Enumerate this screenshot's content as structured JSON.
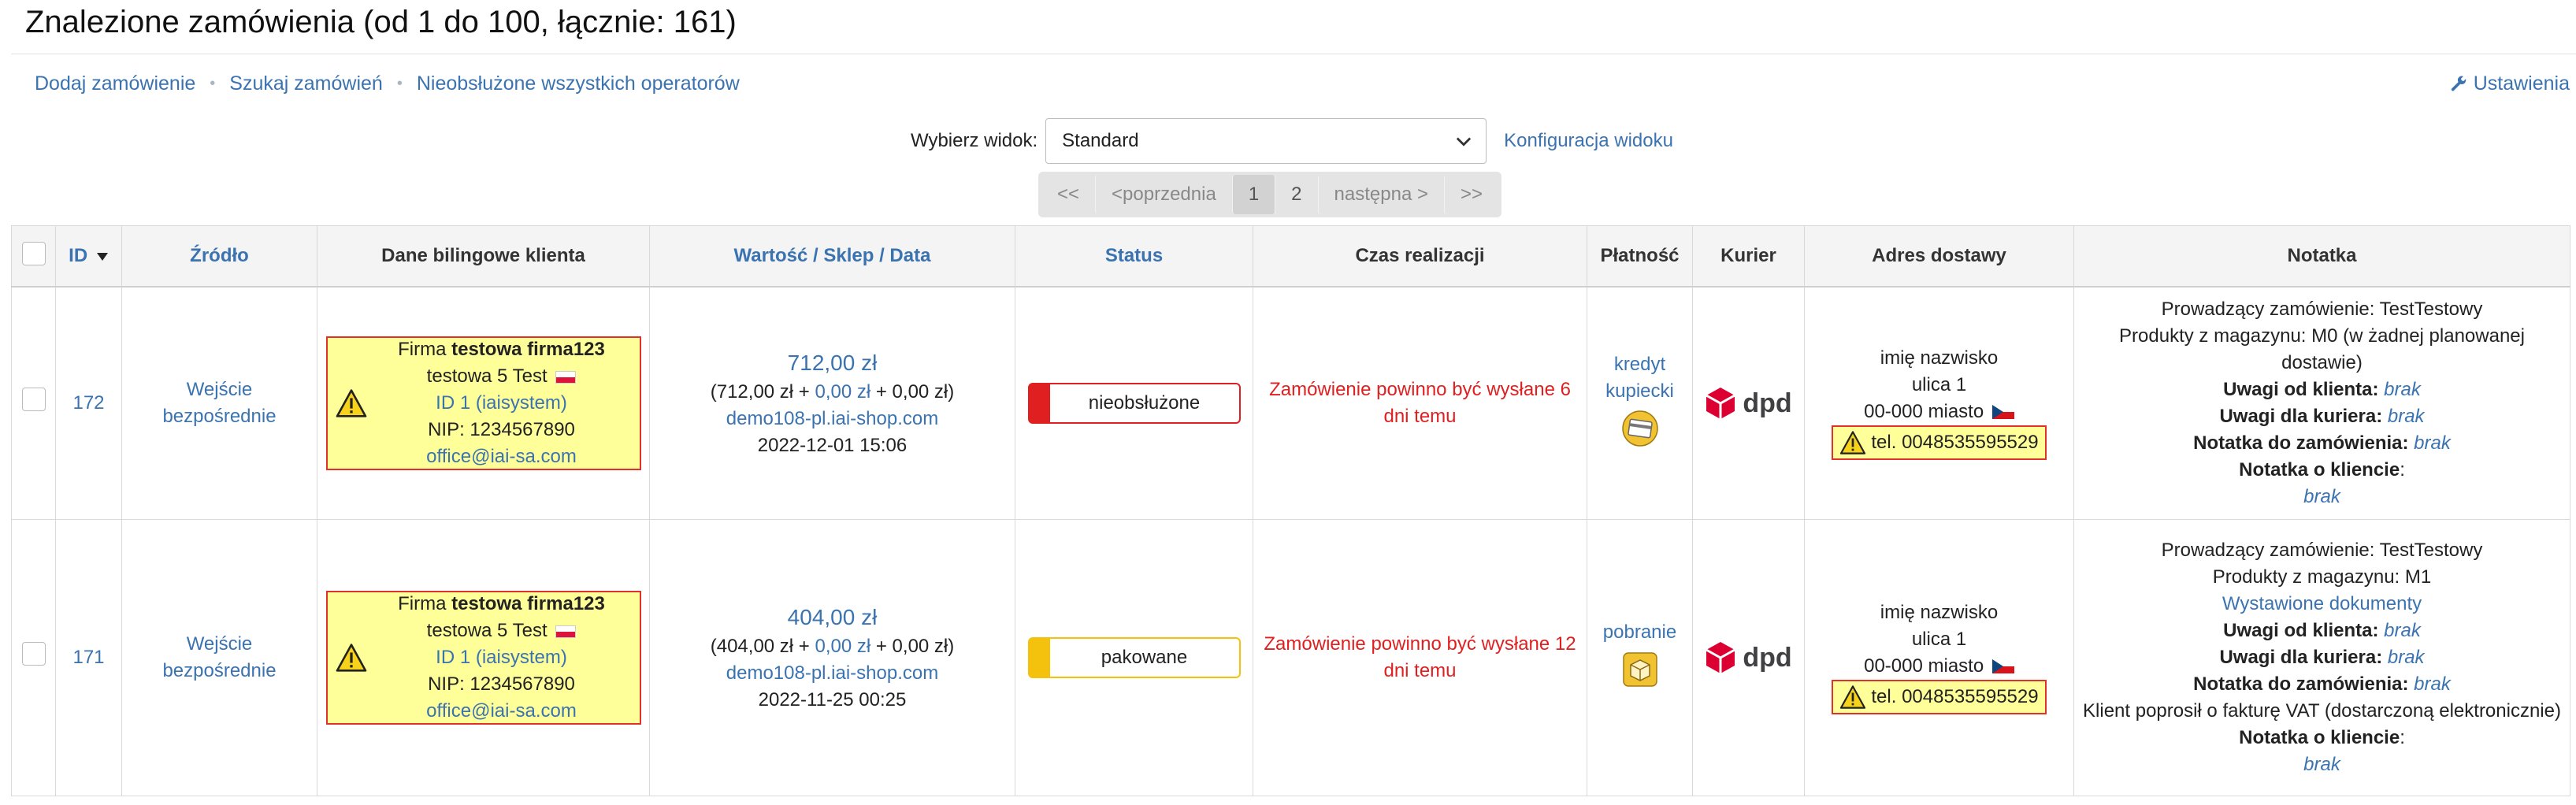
{
  "header": {
    "title": "Znalezione zamówienia (od 1 do 100, łącznie: 161)",
    "links": [
      "Dodaj zamówienie",
      "Szukaj zamówień",
      "Nieobsłużone wszystkich operatorów"
    ],
    "settings_label": "Ustawienia"
  },
  "view": {
    "label": "Wybierz widok:",
    "selected": "Standard",
    "config_label": "Konfiguracja widoku"
  },
  "pager": {
    "first": "<<",
    "prev": "<poprzednia",
    "page1": "1",
    "page2": "2",
    "next": "następna >",
    "last": ">>"
  },
  "table": {
    "headers": {
      "id": "ID",
      "source": "Źródło",
      "billing": "Dane bilingowe klienta",
      "value_a": "Wartość",
      "value_b": "Sklep",
      "value_c": "Data",
      "status": "Status",
      "time": "Czas realizacji",
      "payment": "Płatność",
      "courier": "Kurier",
      "address": "Adres dostawy",
      "note": "Notatka"
    },
    "rows": [
      {
        "id": "172",
        "source": "Wejście bezpośrednie",
        "billing": {
          "firm_prefix": "Firma",
          "firm_name": "testowa firma123",
          "person": "testowa 5 Test",
          "client_id": "ID 1 (iaisystem)",
          "nip": "NIP: 1234567890",
          "email": "office@iai-sa.com"
        },
        "amount": "712,00 zł",
        "breakdown_pre": "(712,00 zł + ",
        "breakdown_link": "0,00 zł",
        "breakdown_post": " + 0,00 zł)",
        "shop": "demo108-pl.iai-shop.com",
        "date": "2022-12-01 15:06",
        "status": "nieobsłużone",
        "status_color": "#e02020",
        "time_text": "Zamówienie powinno być wysłane 6 dni temu",
        "payment": "kredyt kupiecki",
        "payment_icon": "credit-card-icon",
        "courier": "dpd",
        "address": {
          "name": "imię nazwisko",
          "street": "ulica 1",
          "city": "00-000 miasto",
          "phone": "tel. 0048535595529"
        },
        "notes": {
          "operator": "Prowadzący zamówienie: TestTestowy",
          "warehouse": "Produkty z magazynu: M0 (w żadnej planowanej dostawie)",
          "client_label": "Uwagi od klienta:",
          "client_value": "brak",
          "courier_label": "Uwagi dla kuriera:",
          "courier_value": "brak",
          "order_label": "Notatka do zamówienia:",
          "order_value": "brak",
          "about_label": "Notatka o kliencie",
          "about_value": "brak"
        }
      },
      {
        "id": "171",
        "source": "Wejście bezpośrednie",
        "billing": {
          "firm_prefix": "Firma",
          "firm_name": "testowa firma123",
          "person": "testowa 5 Test",
          "client_id": "ID 1 (iaisystem)",
          "nip": "NIP: 1234567890",
          "email": "office@iai-sa.com"
        },
        "amount": "404,00 zł",
        "breakdown_pre": "(404,00 zł + ",
        "breakdown_link": "0,00 zł",
        "breakdown_post": " + 0,00 zł)",
        "shop": "demo108-pl.iai-shop.com",
        "date": "2022-11-25 00:25",
        "status": "pakowane",
        "status_color": "#f4c20d",
        "time_text": "Zamówienie powinno być wysłane 12 dni temu",
        "payment": "pobranie",
        "payment_icon": "cash-on-delivery-icon",
        "courier": "dpd",
        "address": {
          "name": "imię nazwisko",
          "street": "ulica 1",
          "city": "00-000 miasto",
          "phone": "tel. 0048535595529"
        },
        "notes": {
          "operator": "Prowadzący zamówienie: TestTestowy",
          "warehouse": "Produkty z magazynu: M1",
          "documents": "Wystawione dokumenty",
          "client_label": "Uwagi od klienta:",
          "client_value": "brak",
          "courier_label": "Uwagi dla kuriera:",
          "courier_value": "brak",
          "order_label": "Notatka do zamówienia:",
          "order_value": "brak",
          "invoice": "Klient poprosił o fakturę VAT (dostarczoną elektronicznie)",
          "about_label": "Notatka o kliencie",
          "about_value": "brak"
        }
      }
    ]
  }
}
